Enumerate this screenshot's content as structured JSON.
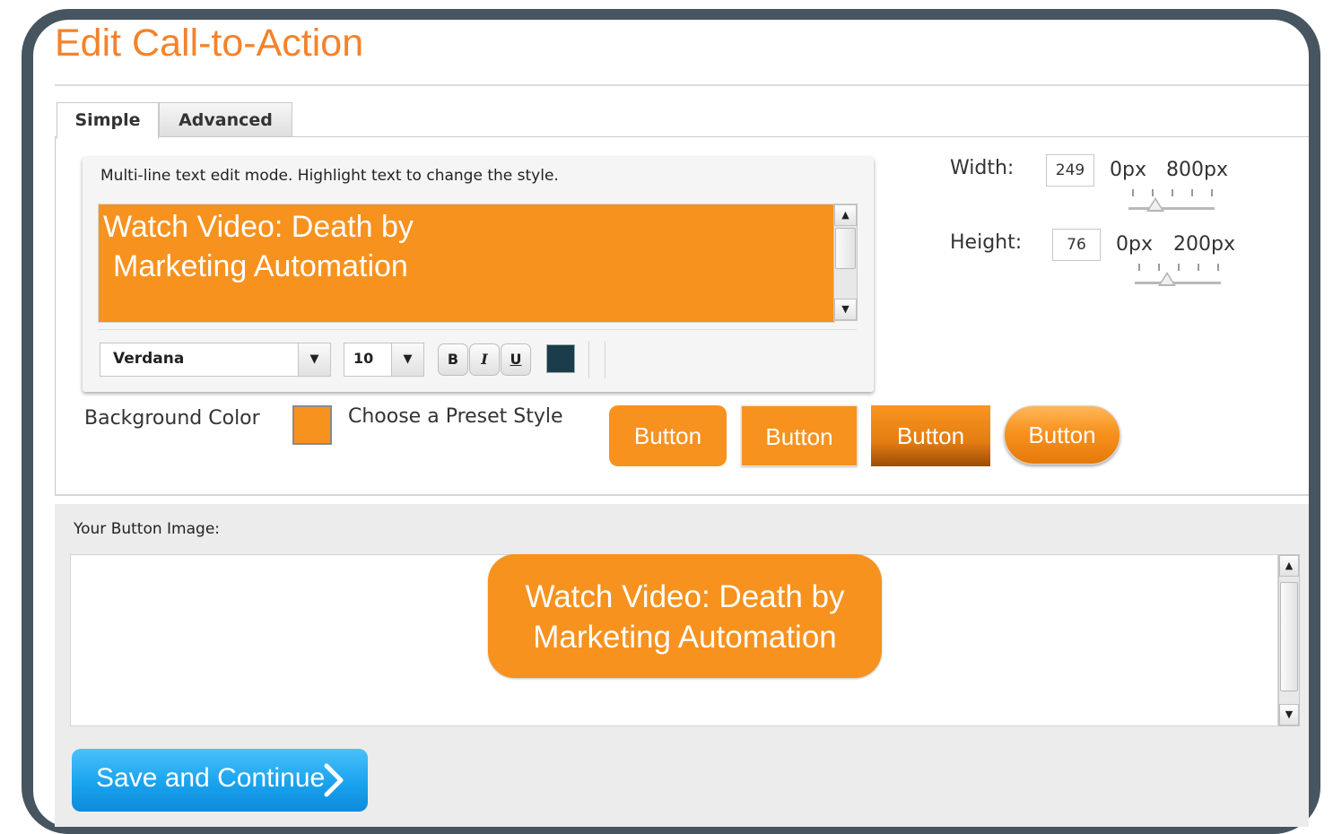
{
  "page": {
    "title": "Edit Call-to-Action"
  },
  "tabs": [
    {
      "label": "Simple",
      "active": true
    },
    {
      "label": "Advanced",
      "active": false
    }
  ],
  "editor": {
    "hint": "Multi-line text edit mode.  Highlight text to change the style.",
    "text_lines": [
      "Watch Video: Death by",
      " Marketing Automation"
    ],
    "text_background": "#f7921e",
    "font": "Verdana",
    "font_size": "10",
    "bold_label": "B",
    "italic_label": "I",
    "underline_label": "U",
    "text_color": "#1b3c4a"
  },
  "background_color": {
    "label": "Background Color",
    "value": "#f7921e"
  },
  "presets": {
    "label": "Choose a Preset Style",
    "buttons": [
      "Button",
      "Button",
      "Button",
      "Button"
    ]
  },
  "dimensions": {
    "width": {
      "label": "Width:",
      "value": "249",
      "min": "0px",
      "max": "800px",
      "fraction": 0.31
    },
    "height": {
      "label": "Height:",
      "value": "76",
      "min": "0px",
      "max": "200px",
      "fraction": 0.38
    }
  },
  "preview": {
    "label": "Your Button Image:",
    "lines": [
      "Watch Video: Death by",
      "Marketing Automation"
    ]
  },
  "actions": {
    "save_label": "Save and Continue"
  },
  "colors": {
    "accent_orange": "#f5822a",
    "button_orange": "#f7921e",
    "save_blue": "#19a3ee",
    "frame": "#46555f"
  }
}
